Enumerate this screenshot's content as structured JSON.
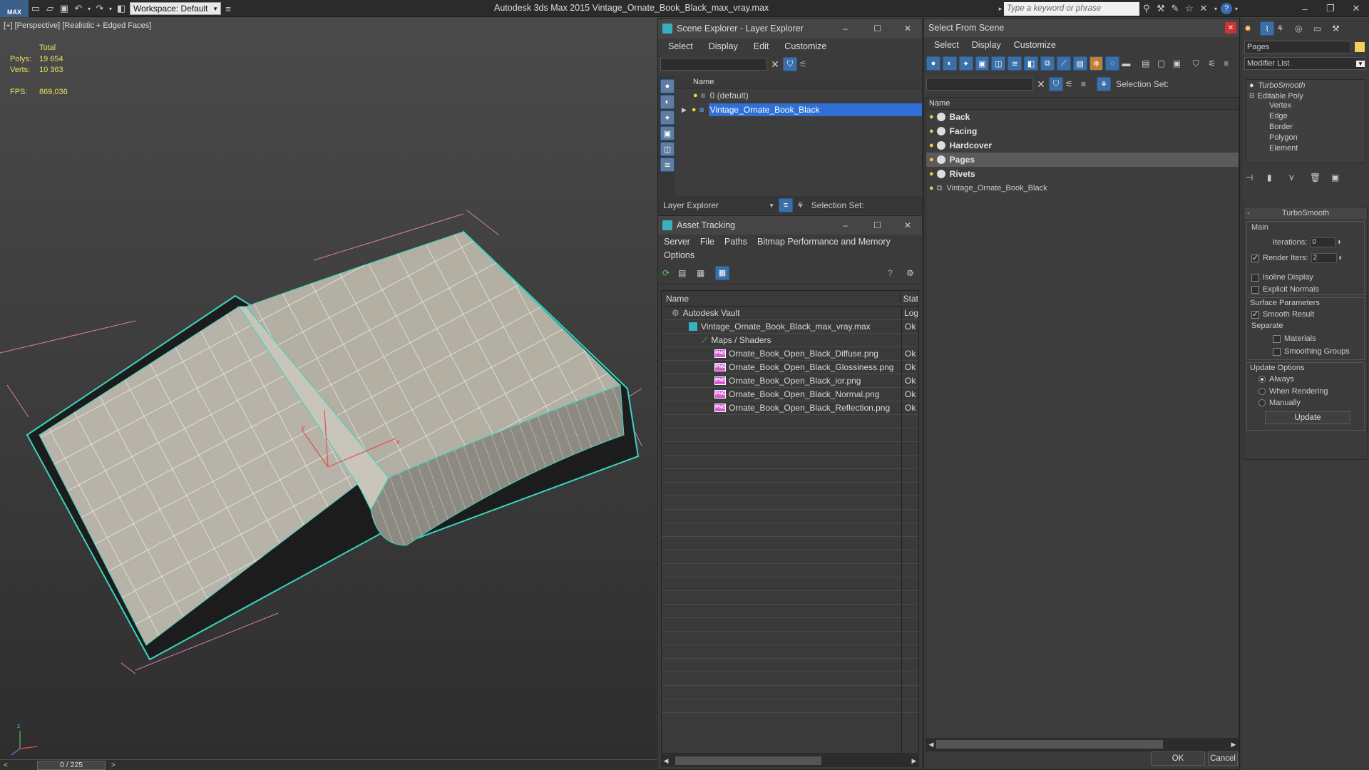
{
  "app": {
    "title": "Autodesk 3ds Max  2015    Vintage_Ornate_Book_Black_max_vray.max",
    "logo": "MAX",
    "workspace": "Workspace: Default",
    "search_placeholder": "Type a keyword or phrase"
  },
  "viewport": {
    "label": "[+] [Perspective] [Realistic + Edged Faces]",
    "stats_total": "Total",
    "polys_label": "Polys:",
    "polys_value": "19 654",
    "verts_label": "Verts:",
    "verts_value": "10 363",
    "fps_label": "FPS:",
    "fps_value": "869,036",
    "timeline": "0 / 225",
    "axis_x": "x",
    "axis_y": "y",
    "axis_z": "z"
  },
  "scene_explorer": {
    "title": "Scene Explorer - Layer Explorer",
    "menu": [
      "Select",
      "Display",
      "Edit",
      "Customize"
    ],
    "col_name": "Name",
    "rows": [
      {
        "label": "0 (default)"
      },
      {
        "label": "Vintage_Ornate_Book_Black"
      }
    ],
    "footer_label": "Layer Explorer",
    "selection_set": "Selection Set:"
  },
  "asset_tracking": {
    "title": "Asset Tracking",
    "menu": [
      "Server",
      "File",
      "Paths",
      "Bitmap Performance and Memory"
    ],
    "menu2": "Options",
    "col_name": "Name",
    "col_status": "Stat",
    "rows": [
      {
        "name": "Autodesk Vault",
        "status": "Log"
      },
      {
        "name": "Vintage_Ornate_Book_Black_max_vray.max",
        "status": "Ok"
      },
      {
        "name": "Maps / Shaders",
        "status": ""
      },
      {
        "name": "Ornate_Book_Open_Black_Diffuse.png",
        "status": "Ok"
      },
      {
        "name": "Ornate_Book_Open_Black_Glossiness.png",
        "status": "Ok"
      },
      {
        "name": "Ornate_Book_Open_Black_ior.png",
        "status": "Ok"
      },
      {
        "name": "Ornate_Book_Open_Black_Normal.png",
        "status": "Ok"
      },
      {
        "name": "Ornate_Book_Open_Black_Reflection.png",
        "status": "Ok"
      }
    ]
  },
  "select_from_scene": {
    "title": "Select From Scene",
    "menu": [
      "Select",
      "Display",
      "Customize"
    ],
    "selection_set": "Selection Set:",
    "col_name": "Name",
    "rows": [
      "Back",
      "Facing",
      "Hardcover",
      "Pages",
      "Rivets",
      "Vintage_Ornate_Book_Black"
    ],
    "ok": "OK",
    "cancel": "Cancel"
  },
  "command_panel": {
    "object_name": "Pages",
    "modifier_list": "Modifier List",
    "stack": [
      "TurboSmooth",
      "Editable Poly",
      "Vertex",
      "Edge",
      "Border",
      "Polygon",
      "Element"
    ],
    "rollout_title": "TurboSmooth",
    "main": "Main",
    "iterations_label": "Iterations:",
    "iterations_value": "0",
    "render_iters_label": "Render Iters:",
    "render_iters_value": "2",
    "isoline": "Isoline Display",
    "explicit_normals": "Explicit Normals",
    "surface_params": "Surface Parameters",
    "smooth_result": "Smooth Result",
    "separate": "Separate",
    "materials": "Materials",
    "smoothing_groups": "Smoothing Groups",
    "update_options": "Update Options",
    "always": "Always",
    "when_rendering": "When Rendering",
    "manually": "Manually",
    "update_btn": "Update"
  },
  "colors": {
    "accent": "#2f6fd6",
    "viewport_bg": "#3a3a3a",
    "wire": "#38d6c0",
    "page": "#b8b3a8"
  }
}
